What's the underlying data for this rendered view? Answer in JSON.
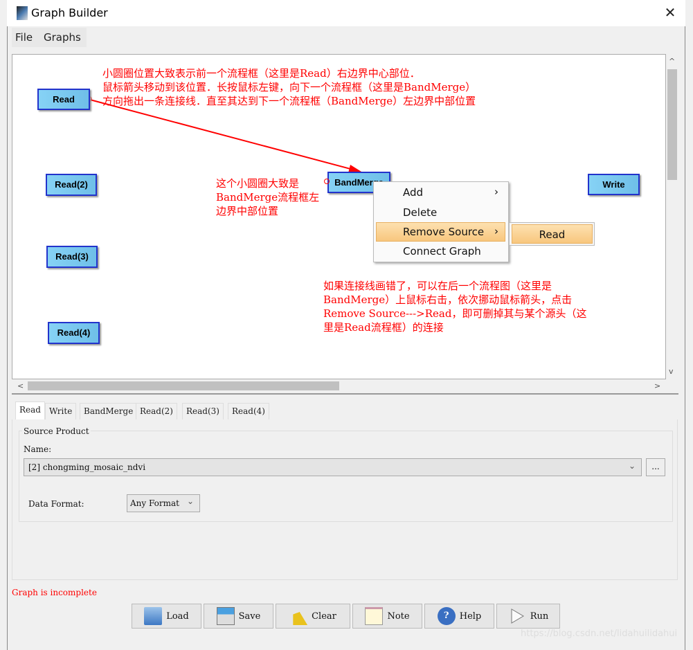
{
  "window": {
    "title": "Graph Builder",
    "close": "✕"
  },
  "menu": [
    "File",
    "Graphs"
  ],
  "nodes": {
    "read": "Read",
    "read2": "Read(2)",
    "read3": "Read(3)",
    "read4": "Read(4)",
    "bandmerge": "BandMerge",
    "write": "Write"
  },
  "annotations": {
    "a1": [
      "小圆圈位置大致表示前一个流程框（这里是Read）右边界中心部位．",
      "鼠标箭头移动到该位置．长按鼠标左键，向下一个流程框（这里是BandMerge）",
      "方向拖出一条连接线．直至其达到下一个流程框（BandMerge）左边界中部位置"
    ],
    "a2": [
      "这个小圆圈大致是",
      "BandMerge流程框左",
      "边界中部位置"
    ],
    "a3": [
      "如果连接线画错了，可以在后一个流程图（这里是",
      "BandMerge）上鼠标右击，依次挪动鼠标箭头，点击",
      "Remove Source--->Read，即可删掉其与某个源头（这",
      "里是Read流程框）的连接"
    ]
  },
  "context_menu": {
    "items": [
      "Add",
      "Delete",
      "Remove Source",
      "Connect Graph"
    ],
    "submenu": [
      "Read"
    ],
    "chevron": "›"
  },
  "scroll": {
    "left": "<",
    "right": ">",
    "up": "^",
    "down": "v"
  },
  "tabs": [
    "Read",
    "Write",
    "BandMerge",
    "Read(2)",
    "Read(3)",
    "Read(4)"
  ],
  "panel": {
    "group_title": "Source Product",
    "name_label": "Name:",
    "name_value": "[2] chongming_mosaic_ndvi",
    "browse": "...",
    "format_label": "Data Format:",
    "format_value": "Any Format"
  },
  "status": "Graph is incomplete",
  "buttons": [
    {
      "label": "Load",
      "icon": "folder-icon"
    },
    {
      "label": "Save",
      "icon": "save-icon"
    },
    {
      "label": "Clear",
      "icon": "broom-icon"
    },
    {
      "label": "Note",
      "icon": "notepad-icon"
    },
    {
      "label": "Help",
      "icon": "help-icon"
    },
    {
      "label": "Run",
      "icon": "play-icon"
    }
  ],
  "watermark": "https://blog.csdn.net/lidahuilidahui",
  "colors": {
    "node": "#7ccaf0",
    "annotation": "#ff0000",
    "highlight": "#f8c77e"
  }
}
